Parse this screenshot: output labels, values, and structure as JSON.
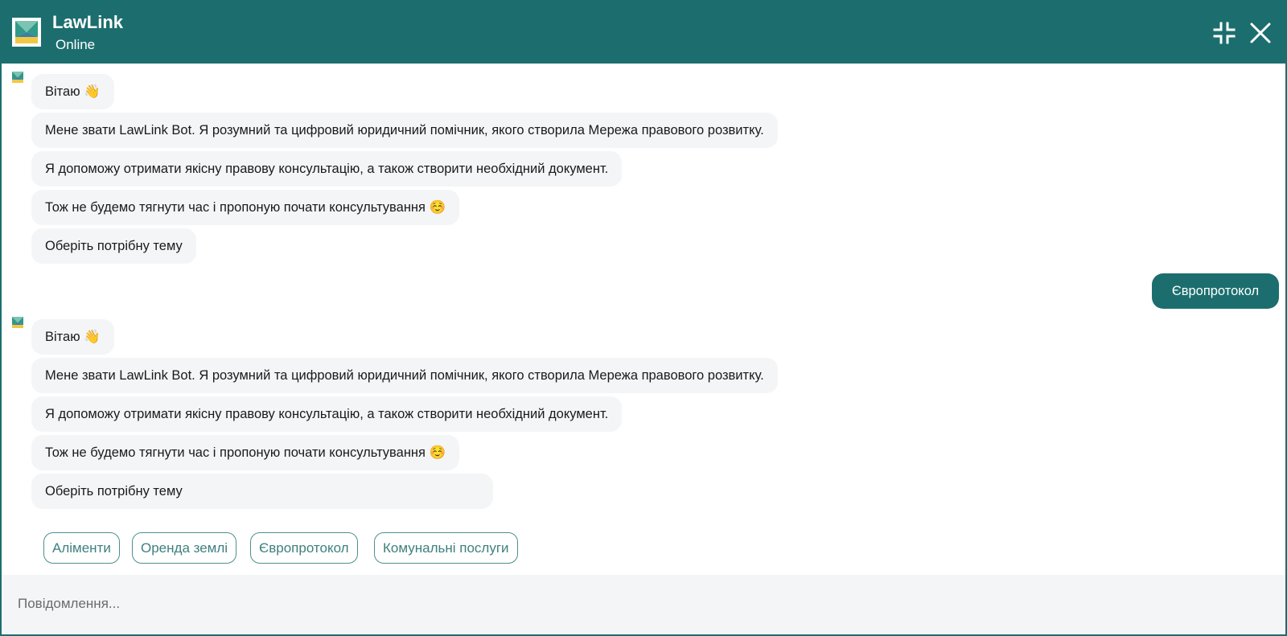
{
  "header": {
    "title": "LawLink",
    "status": "Online",
    "logo_icon": "lawlink-logo",
    "collapse_icon": "collapse-icon",
    "close_icon": "close-icon",
    "color": "#1c6e6e"
  },
  "conversation": {
    "bot_group_1": [
      "Вітаю 👋",
      "Мене звати LawLink Bot. Я розумний та цифровий юридичний помічник, якого створила Мережа правового розвитку.",
      "Я допоможу отримати якісну правову консультацію, а також створити необхідний документ.",
      "Тож не будемо тягнути час і пропоную почати консультування ☺️",
      "Оберіть потрібну тему"
    ],
    "user_message": "Європротокол",
    "bot_group_2": [
      "Вітаю 👋",
      "Мене звати LawLink Bot. Я розумний та цифровий юридичний помічник, якого створила Мережа правового розвитку.",
      "Я допоможу отримати якісну правову консультацію, а також створити необхідний документ.",
      "Тож не будемо тягнути час і пропоную почати консультування ☺️",
      "Оберіть потрібну тему"
    ],
    "quick_replies": [
      "Аліменти",
      "Оренда землі",
      "Європротокол",
      "Комунальні послуги"
    ]
  },
  "composer": {
    "placeholder": "Повідомлення..."
  }
}
